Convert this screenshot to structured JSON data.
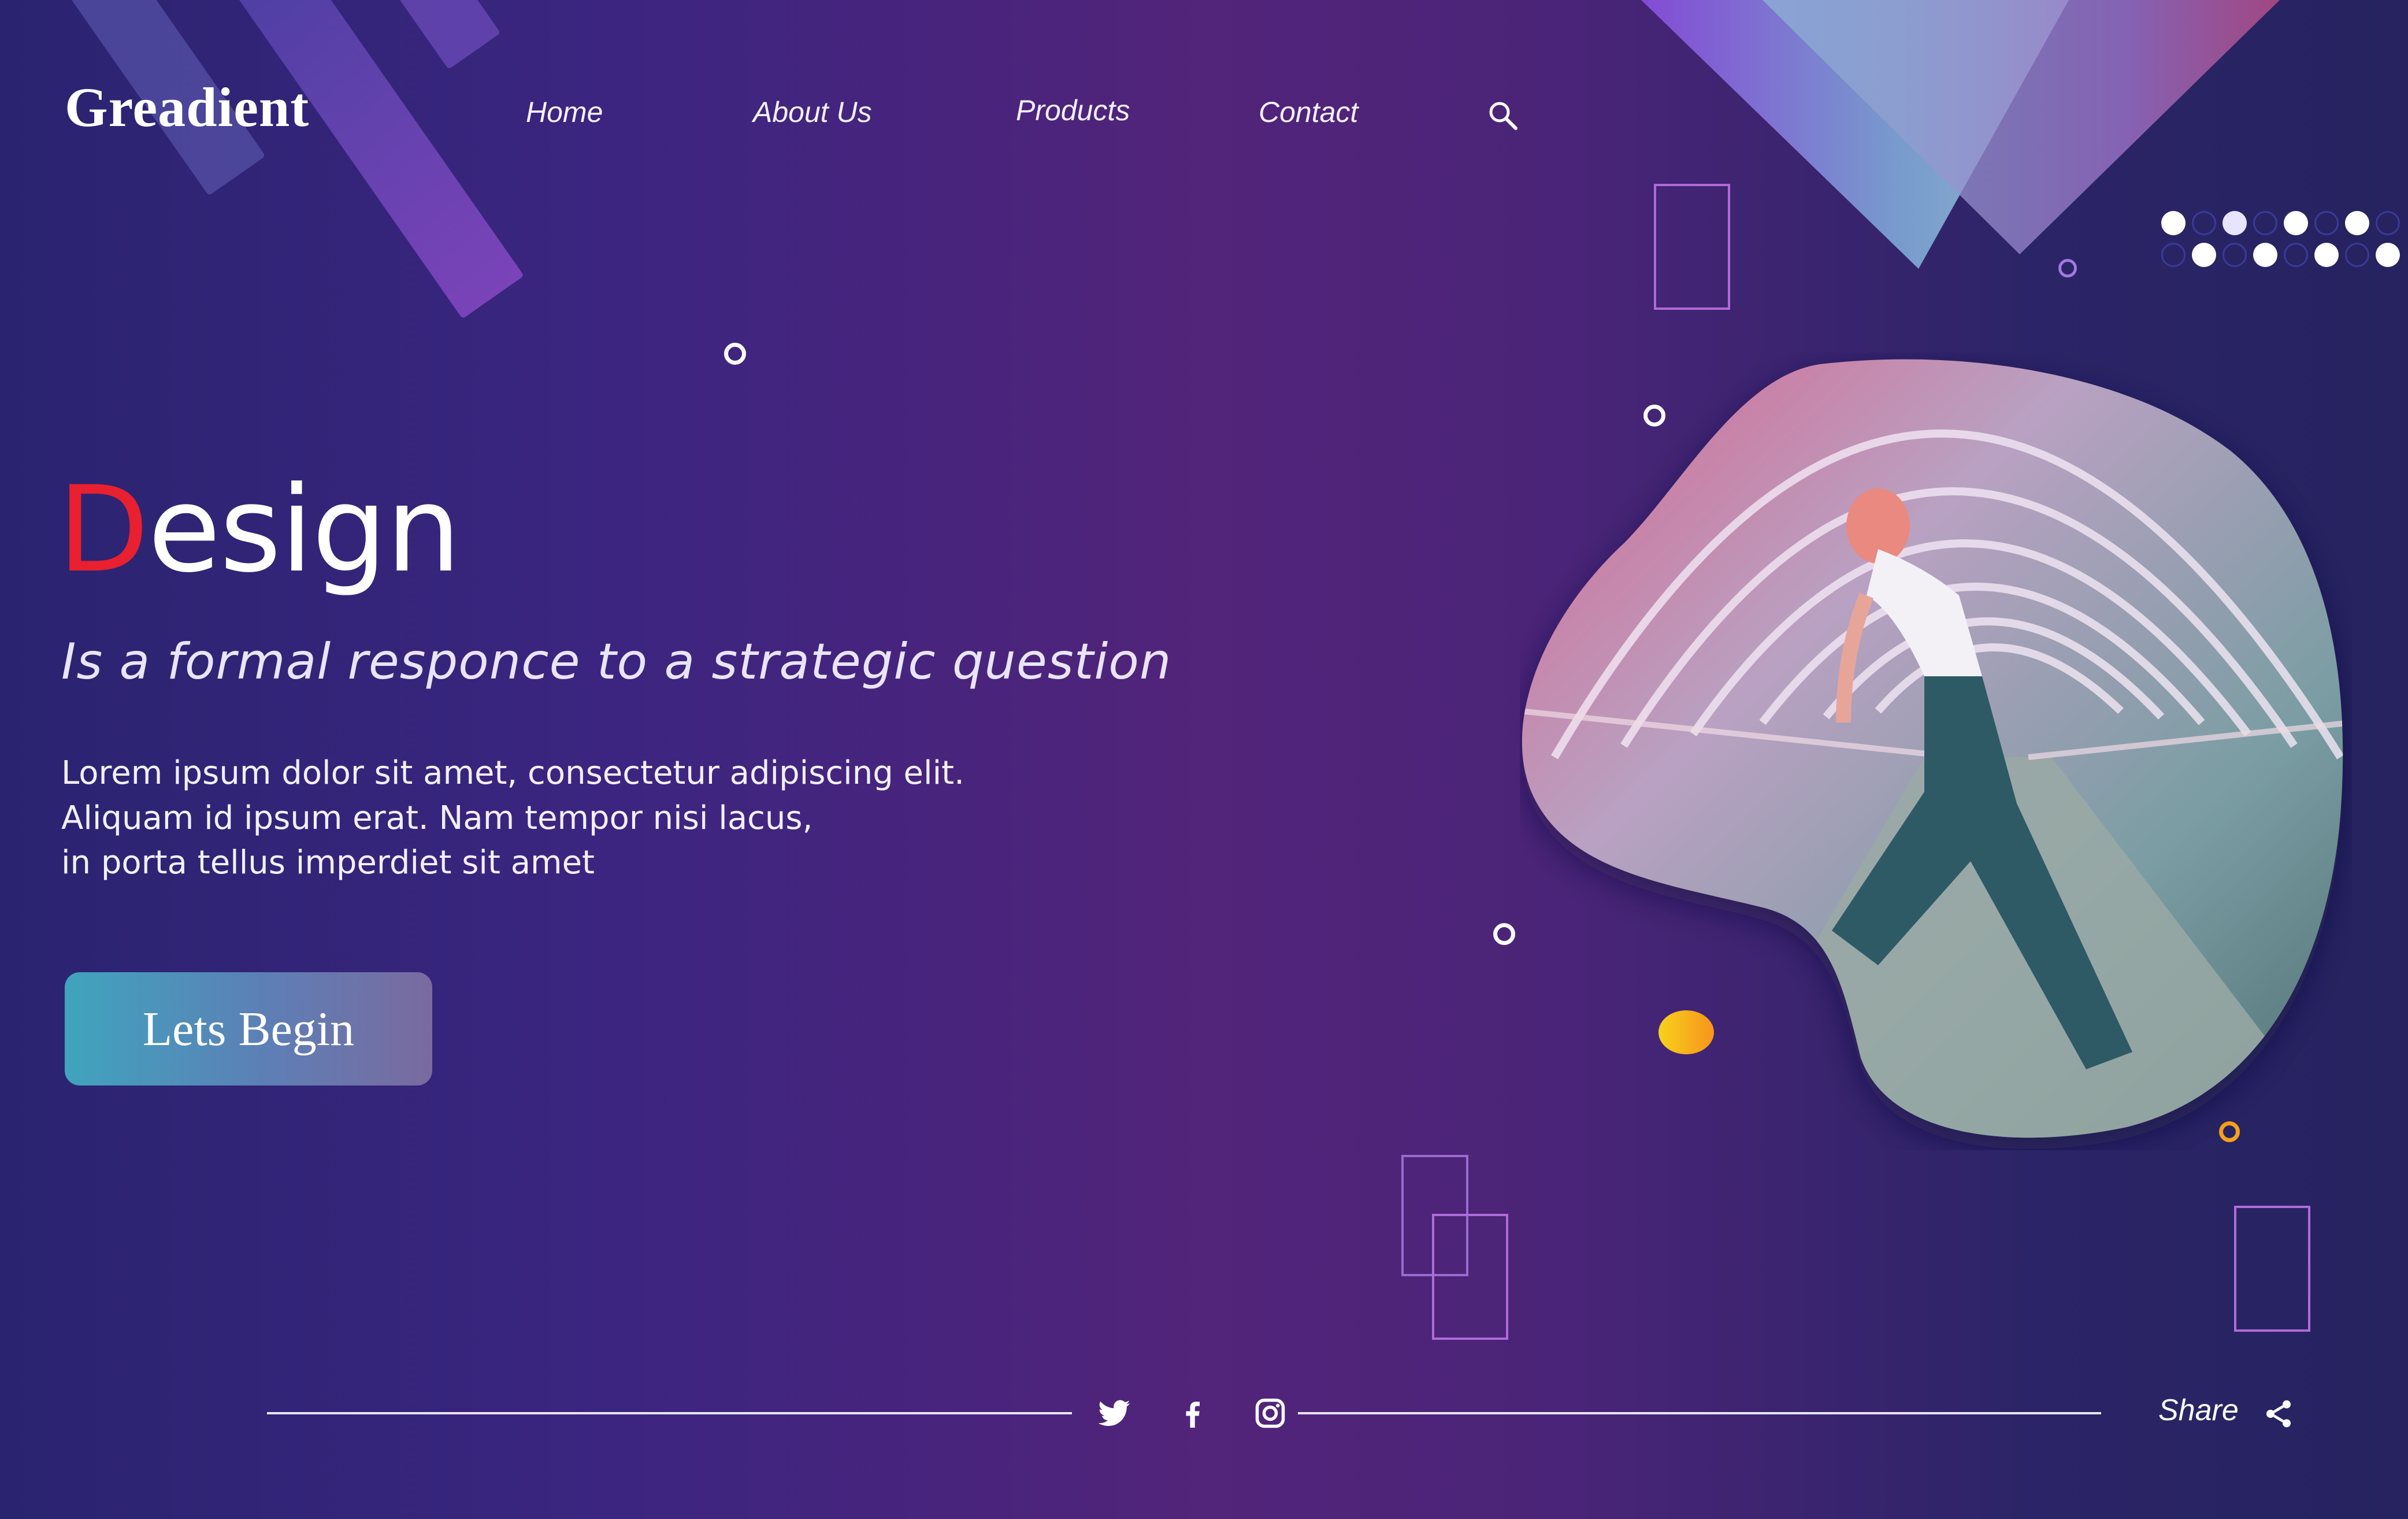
{
  "brand": {
    "name": "Greadient"
  },
  "nav": {
    "items": [
      {
        "label": "Home"
      },
      {
        "label": "About Us"
      },
      {
        "label": "Products"
      },
      {
        "label": "Contact"
      }
    ],
    "search_icon": "search-icon"
  },
  "hero": {
    "title_first_letter": "D",
    "title_rest": "esign",
    "subtitle": "Is a formal responce to a strategic question",
    "body_lines": [
      "Lorem ipsum dolor sit amet, consectetur adipiscing elit.",
      "Aliquam id ipsum erat. Nam tempor nisi lacus,",
      "in porta tellus imperdiet sit amet"
    ],
    "cta_label": "Lets Begin"
  },
  "footer": {
    "social": [
      "twitter-icon",
      "facebook-icon",
      "instagram-icon"
    ],
    "share_label": "Share",
    "share_icon": "share-icon"
  },
  "colors": {
    "accent_red": "#e8202f",
    "cta_start": "#3fa4bd",
    "cta_end": "#7a6a9e",
    "orange_dot": "#f7a21b"
  }
}
